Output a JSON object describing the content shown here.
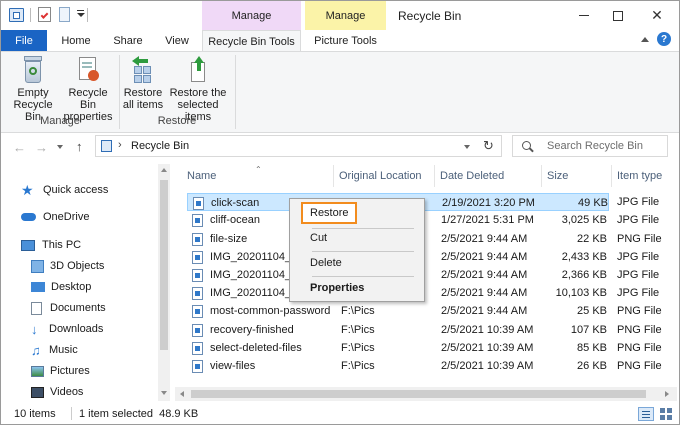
{
  "window": {
    "title": "Recycle Bin"
  },
  "title_bar": {
    "context_manage_1": "Manage",
    "context_manage_2": "Manage",
    "minimize": "–",
    "maximize": "☐",
    "close": "✕"
  },
  "tabs": {
    "file": "File",
    "home": "Home",
    "share": "Share",
    "view": "View",
    "recycle_bin_tools": "Recycle Bin Tools",
    "picture_tools": "Picture Tools"
  },
  "ribbon": {
    "empty_line1": "Empty",
    "empty_line2": "Recycle Bin",
    "props_line1": "Recycle Bin",
    "props_line2": "properties",
    "manage_group": "Manage",
    "restore_all_line1": "Restore",
    "restore_all_line2": "all items",
    "restore_sel_line1": "Restore the",
    "restore_sel_line2": "selected items",
    "restore_group": "Restore"
  },
  "address": {
    "path": "Recycle Bin",
    "search_placeholder": "Search Recycle Bin"
  },
  "sidebar": {
    "quick_access": "Quick access",
    "onedrive": "OneDrive",
    "this_pc": "This PC",
    "objects3d": "3D Objects",
    "desktop": "Desktop",
    "documents": "Documents",
    "downloads": "Downloads",
    "music": "Music",
    "pictures": "Pictures",
    "videos": "Videos"
  },
  "columns": {
    "name": "Name",
    "original_location": "Original Location",
    "date_deleted": "Date Deleted",
    "size": "Size",
    "item_type": "Item type"
  },
  "files": [
    {
      "name": "click-scan",
      "location": "",
      "date": "2/19/2021 3:20 PM",
      "size": "49 KB",
      "type": "JPG File"
    },
    {
      "name": "cliff-ocean",
      "location": "",
      "date": "1/27/2021 5:31 PM",
      "size": "3,025 KB",
      "type": "JPG File"
    },
    {
      "name": "file-size",
      "location": "",
      "date": "2/5/2021 9:44 AM",
      "size": "22 KB",
      "type": "PNG File"
    },
    {
      "name": "IMG_20201104_(",
      "location": "",
      "date": "2/5/2021 9:44 AM",
      "size": "2,433 KB",
      "type": "JPG File"
    },
    {
      "name": "IMG_20201104_(",
      "location": "",
      "date": "2/5/2021 9:44 AM",
      "size": "2,366 KB",
      "type": "JPG File"
    },
    {
      "name": "IMG_20201104_(",
      "location": "",
      "date": "2/5/2021 9:44 AM",
      "size": "10,103 KB",
      "type": "JPG File"
    },
    {
      "name": "most-common-password",
      "location": "F:\\Pics",
      "date": "2/5/2021 9:44 AM",
      "size": "25 KB",
      "type": "PNG File"
    },
    {
      "name": "recovery-finished",
      "location": "F:\\Pics",
      "date": "2/5/2021 10:39 AM",
      "size": "107 KB",
      "type": "PNG File"
    },
    {
      "name": "select-deleted-files",
      "location": "F:\\Pics",
      "date": "2/5/2021 10:39 AM",
      "size": "85 KB",
      "type": "PNG File"
    },
    {
      "name": "view-files",
      "location": "F:\\Pics",
      "date": "2/5/2021 10:39 AM",
      "size": "26 KB",
      "type": "PNG File"
    }
  ],
  "context_menu": {
    "restore": "Restore",
    "cut": "Cut",
    "delete": "Delete",
    "properties": "Properties"
  },
  "status": {
    "count": "10 items",
    "selected": "1 item selected  48.9 KB"
  },
  "colors": {
    "manage_tab": "#f0d9f7",
    "picture_manage_tab": "#fbf3a8",
    "file_tab": "#1a64c4",
    "selection": "#cce8ff",
    "highlight_box": "#f28c1e"
  }
}
